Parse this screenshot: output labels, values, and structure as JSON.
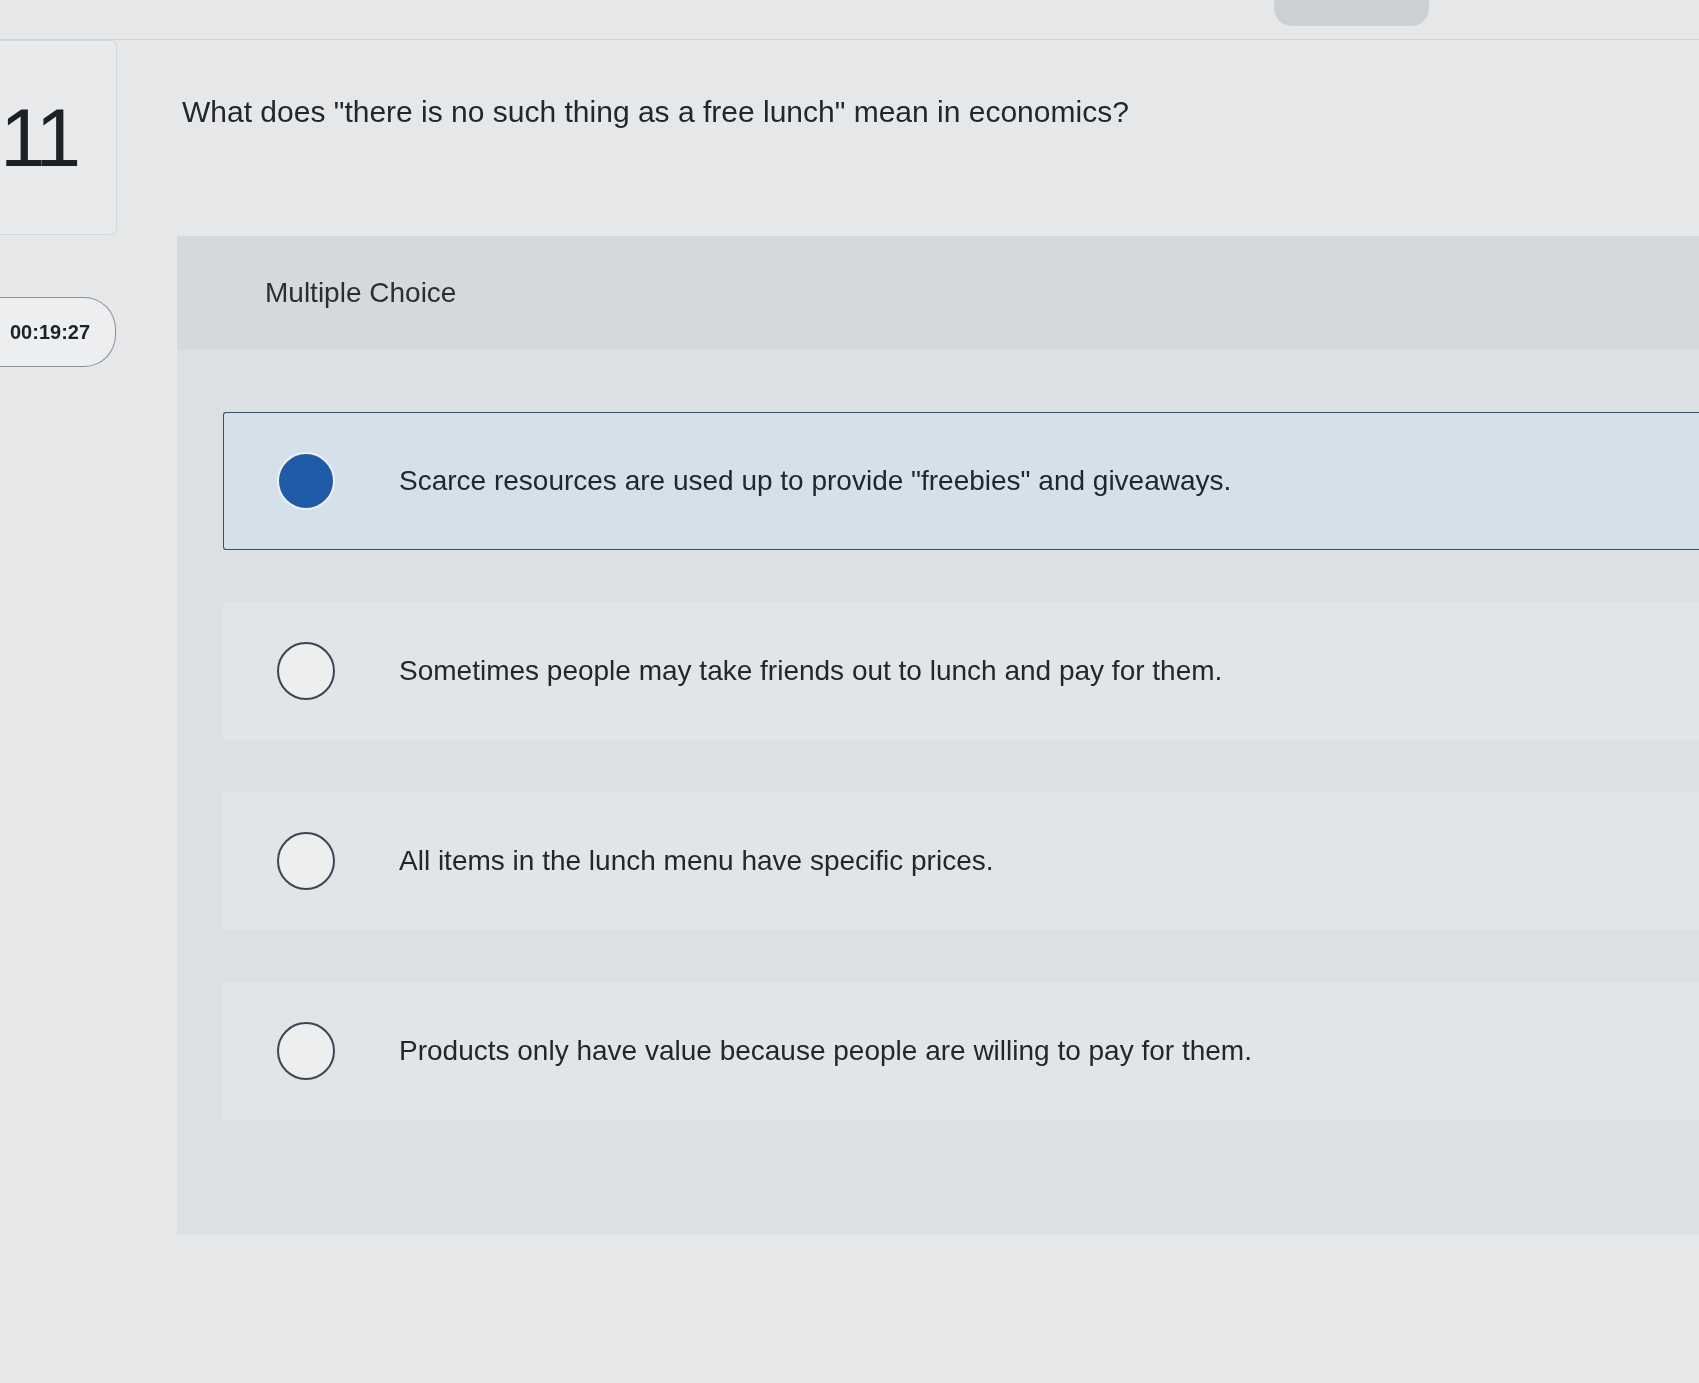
{
  "question": {
    "number": "11",
    "text": "What does \"there is no such thing as a free lunch\" mean in economics?"
  },
  "timer": "00:19:27",
  "answer_panel": {
    "title": "Multiple Choice",
    "options": [
      {
        "text": "Scarce resources are used up to provide \"freebies\" and giveaways.",
        "selected": true
      },
      {
        "text": "Sometimes people may take friends out to lunch and pay for them.",
        "selected": false
      },
      {
        "text": "All items in the lunch menu have specific prices.",
        "selected": false
      },
      {
        "text": "Products only have value because people are willing to pay for them.",
        "selected": false
      }
    ]
  }
}
